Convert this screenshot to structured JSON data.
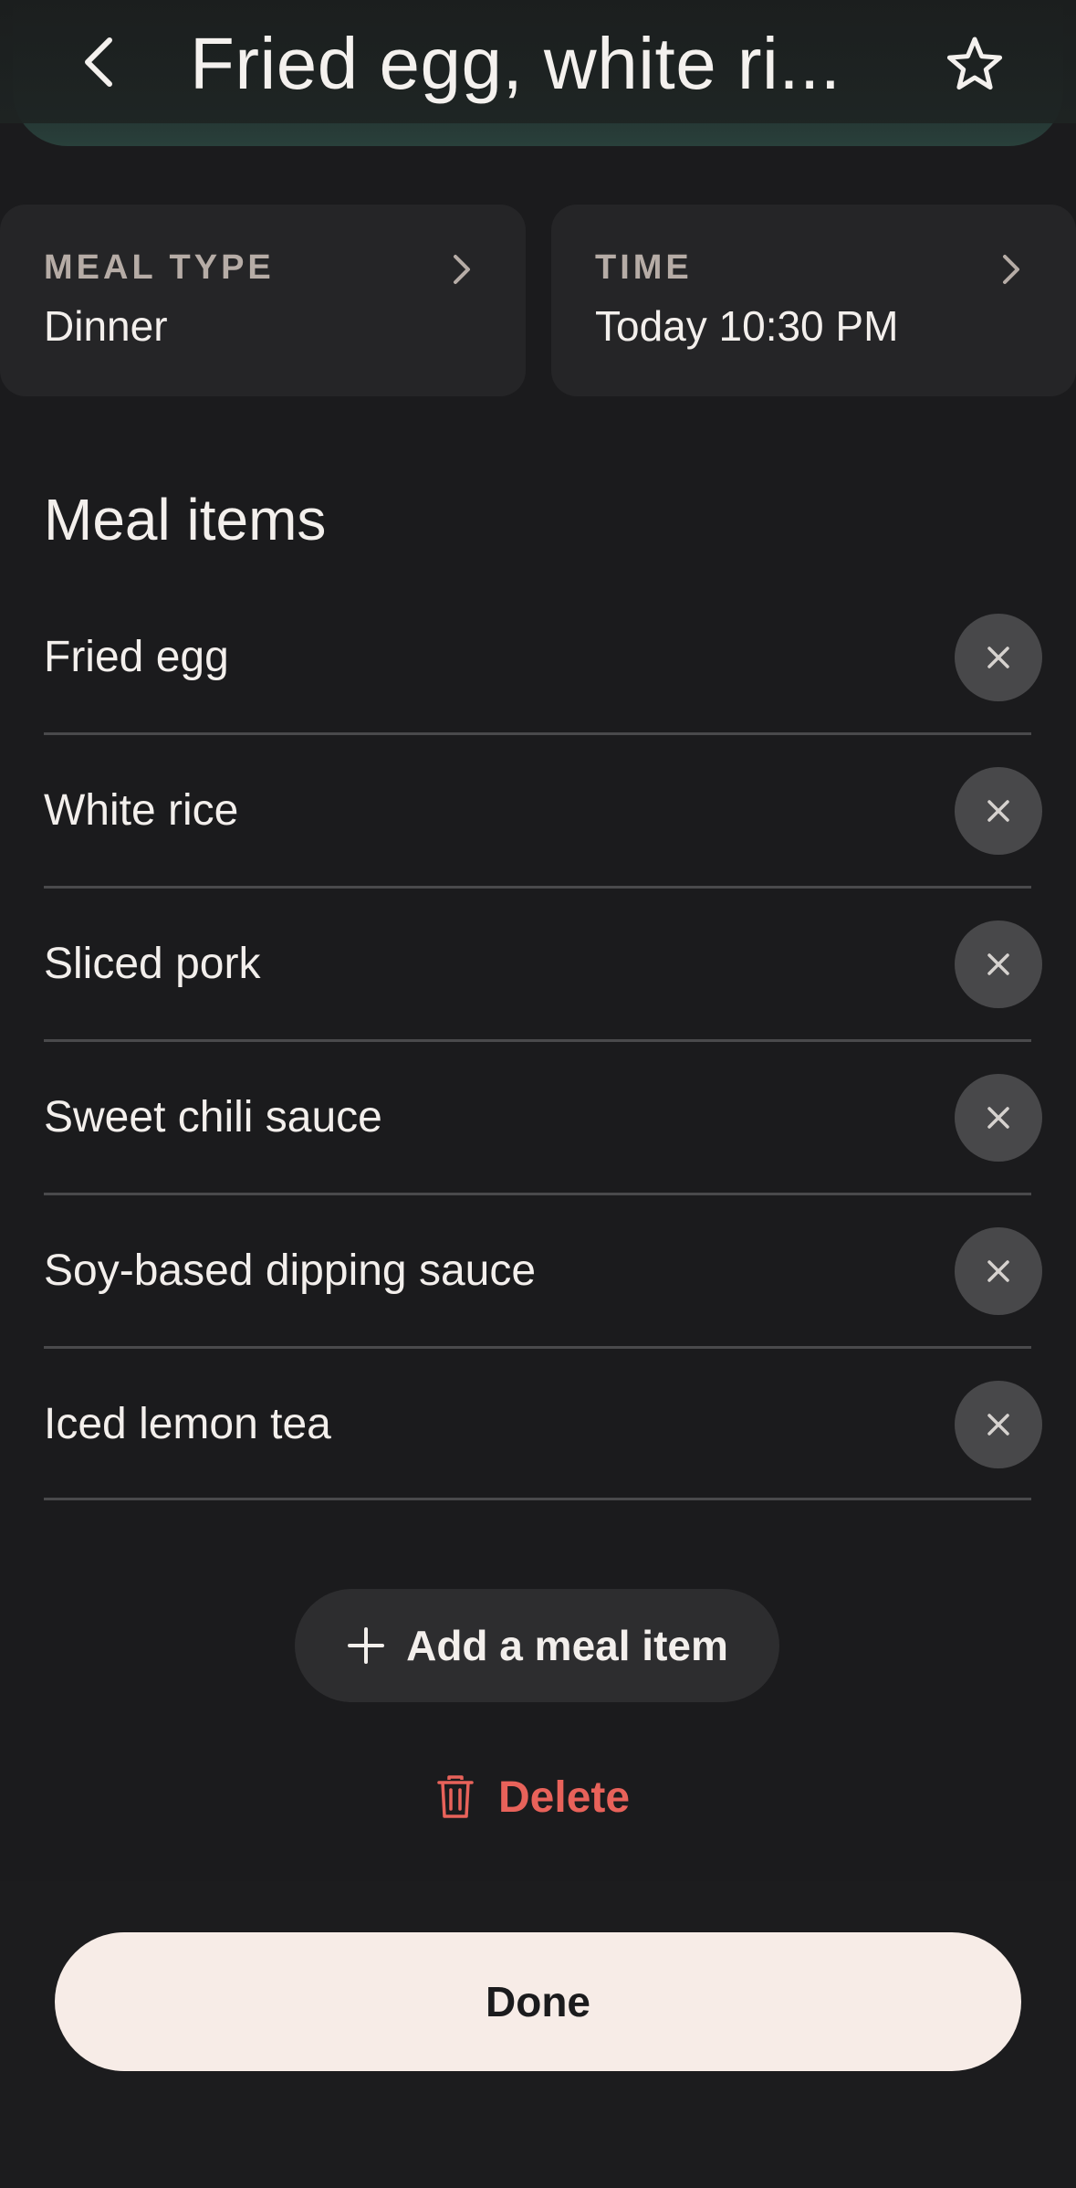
{
  "header": {
    "title": "Fried egg, white ri...",
    "back_icon": "chevron-left-icon",
    "favorite_icon": "star-outline-icon"
  },
  "details": {
    "meal_type": {
      "label": "MEAL TYPE",
      "value": "Dinner"
    },
    "time": {
      "label": "TIME",
      "value": "Today 10:30 PM"
    }
  },
  "meal_items": {
    "title": "Meal items",
    "items": [
      {
        "label": "Fried egg"
      },
      {
        "label": "White rice"
      },
      {
        "label": "Sliced pork"
      },
      {
        "label": "Sweet chili sauce"
      },
      {
        "label": "Soy-based dipping sauce"
      },
      {
        "label": "Iced lemon tea"
      }
    ],
    "remove_icon": "close-icon"
  },
  "actions": {
    "add_label": "Add a meal item",
    "add_icon": "plus-icon",
    "delete_label": "Delete",
    "delete_icon": "trash-icon",
    "done_label": "Done"
  },
  "colors": {
    "background": "#1b1b1d",
    "card": "#252527",
    "accent_delete": "#e8625a",
    "done_button": "#f7ece7"
  }
}
